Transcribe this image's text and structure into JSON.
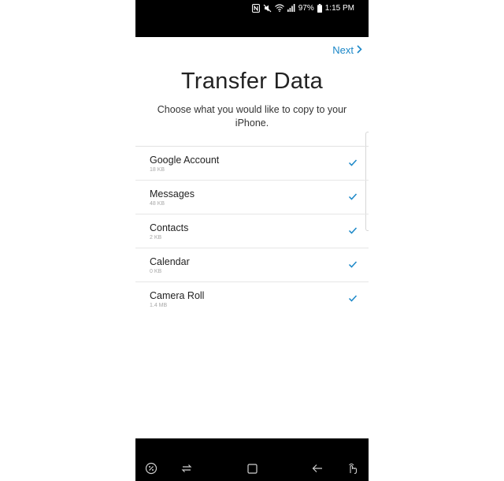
{
  "status_bar": {
    "battery": "97%",
    "time": "1:15 PM",
    "icons": [
      "nfc-icon",
      "mute-icon",
      "wifi-icon",
      "signal-icon",
      "battery-icon"
    ]
  },
  "header": {
    "next_label": "Next"
  },
  "main": {
    "title": "Transfer Data",
    "subtitle": "Choose what you would like to copy to your iPhone."
  },
  "items": [
    {
      "name": "Google Account",
      "size": "18 KB",
      "checked": true
    },
    {
      "name": "Messages",
      "size": "48 KB",
      "checked": true
    },
    {
      "name": "Contacts",
      "size": "2 KB",
      "checked": true
    },
    {
      "name": "Calendar",
      "size": "0 KB",
      "checked": true
    },
    {
      "name": "Camera Roll",
      "size": "1.4 MB",
      "checked": true
    }
  ],
  "nav": {
    "icons": [
      "edge-handle-icon",
      "recents-icon",
      "home-icon",
      "back-icon",
      "gesture-icon"
    ]
  },
  "colors": {
    "accent": "#1a87c8",
    "text": "#222222",
    "bars": "#000000"
  }
}
